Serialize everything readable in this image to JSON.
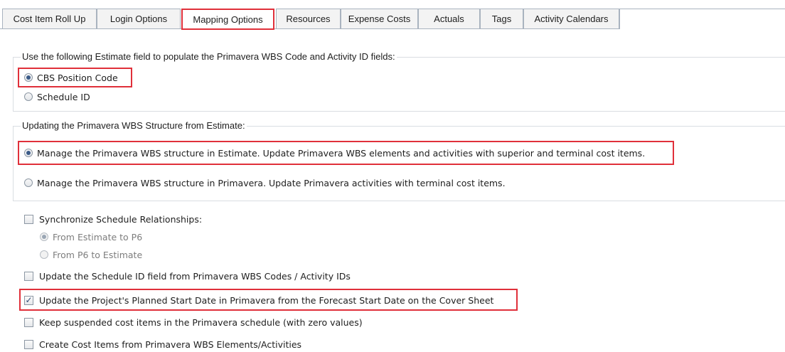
{
  "tabs": [
    {
      "label": "Cost Item Roll Up"
    },
    {
      "label": "Login Options"
    },
    {
      "label": "Mapping Options"
    },
    {
      "label": "Resources"
    },
    {
      "label": "Expense Costs"
    },
    {
      "label": "Actuals"
    },
    {
      "label": "Tags"
    },
    {
      "label": "Activity Calendars"
    }
  ],
  "active_tab": "Mapping Options",
  "estimate_field_group": {
    "legend": "Use the following Estimate field to populate the Primavera WBS Code and Activity ID fields:",
    "options": [
      {
        "label": "CBS Position Code",
        "selected": true
      },
      {
        "label": "Schedule ID",
        "selected": false
      }
    ]
  },
  "wbs_structure_group": {
    "legend": "Updating the Primavera WBS Structure from Estimate:",
    "options": [
      {
        "label": "Manage the Primavera WBS structure in Estimate. Update Primavera WBS elements and activities with superior and terminal cost items.",
        "selected": true
      },
      {
        "label": "Manage the Primavera WBS structure in Primavera. Update Primavera activities with terminal cost items.",
        "selected": false
      }
    ]
  },
  "sync_relationships": {
    "label": "Synchronize Schedule Relationships:",
    "checked": false,
    "options": [
      {
        "label": "From Estimate to P6",
        "selected": true
      },
      {
        "label": "From P6 to Estimate",
        "selected": false
      }
    ]
  },
  "checkboxes": [
    {
      "label": "Update the Schedule ID field from Primavera WBS Codes / Activity IDs",
      "checked": false
    },
    {
      "label": "Update the Project's Planned Start Date in Primavera from the Forecast Start Date on the Cover Sheet",
      "checked": true
    },
    {
      "label": "Keep suspended cost items in the Primavera schedule (with zero values)",
      "checked": false
    },
    {
      "label": "Create Cost Items from Primavera WBS Elements/Activities",
      "checked": false
    }
  ],
  "colors": {
    "highlight": "#e0303a",
    "radio_dot": "#3b5b88",
    "border": "#a9b3bf"
  }
}
